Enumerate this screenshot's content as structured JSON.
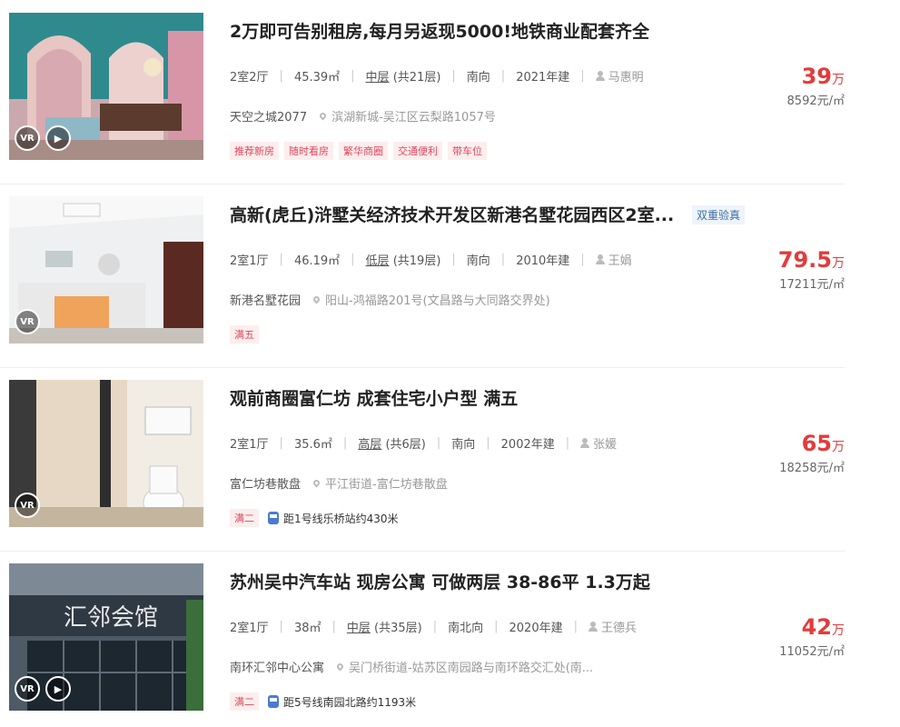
{
  "listings": [
    {
      "title": "2万即可告别租房,每月另返现5000!地铁商业配套齐全",
      "layout": "2室2厅",
      "area": "45.39㎡",
      "floor_level": "中层",
      "floor_total": "(共21层)",
      "orientation": "南向",
      "year": "2021年建",
      "agent": "马惠明",
      "community": "天空之城2077",
      "address": "滨湖新城-吴江区云梨路1057号",
      "tags": [
        "推荐新房",
        "随时看房",
        "繁华商圈",
        "交通便利",
        "带车位"
      ],
      "subway": "",
      "price_total": "39",
      "price_unit": "万",
      "unit_price": "8592元/㎡",
      "has_play": true,
      "badge": ""
    },
    {
      "title": "高新(虎丘)浒墅关经济技术开发区新港名墅花园西区2室...",
      "layout": "2室1厅",
      "area": "46.19㎡",
      "floor_level": "低层",
      "floor_total": "(共19层)",
      "orientation": "南向",
      "year": "2010年建",
      "agent": "王娟",
      "community": "新港名墅花园",
      "address": "阳山-鸿福路201号(文昌路与大同路交界处)",
      "tags": [
        "满五"
      ],
      "subway": "",
      "price_total": "79.5",
      "price_unit": "万",
      "unit_price": "17211元/㎡",
      "has_play": false,
      "badge": "双重验真"
    },
    {
      "title": "观前商圈富仁坊 成套住宅小户型 满五",
      "layout": "2室1厅",
      "area": "35.6㎡",
      "floor_level": "高层",
      "floor_total": "(共6层)",
      "orientation": "南向",
      "year": "2002年建",
      "agent": "张媛",
      "community": "富仁坊巷散盘",
      "address": "平江街道-富仁坊巷散盘",
      "tags": [
        "满二"
      ],
      "subway": "距1号线乐桥站约430米",
      "price_total": "65",
      "price_unit": "万",
      "unit_price": "18258元/㎡",
      "has_play": false,
      "badge": ""
    },
    {
      "title": "苏州吴中汽车站 现房公寓 可做两层 38-86平 1.3万起",
      "layout": "2室1厅",
      "area": "38㎡",
      "floor_level": "中层",
      "floor_total": "(共35层)",
      "orientation": "南北向",
      "year": "2020年建",
      "agent": "王德兵",
      "community": "南环汇邻中心公寓",
      "address": "吴门桥街道-姑苏区南园路与南环路交汇处(南...",
      "tags": [
        "满二"
      ],
      "subway": "距5号线南园北路约1193米",
      "price_total": "42",
      "price_unit": "万",
      "unit_price": "11052元/㎡",
      "has_play": true,
      "badge": ""
    }
  ],
  "vr_label": "VR",
  "play_icon": "▶",
  "photo_signs": [
    "汇邻会馆"
  ]
}
